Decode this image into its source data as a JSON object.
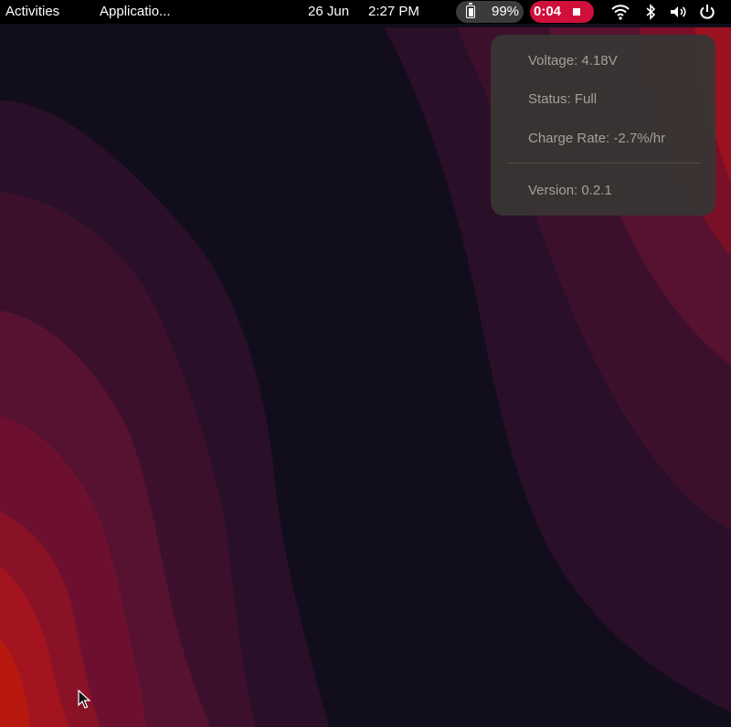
{
  "topbar": {
    "activities": "Activities",
    "applications": "Applicatio...",
    "date": "26 Jun",
    "time": "2:27 PM",
    "battery_percent": "99%",
    "recording_time": "0:04",
    "icons": [
      "battery-icon",
      "stop-icon",
      "wifi-icon",
      "bluetooth-icon",
      "volume-icon",
      "power-icon"
    ]
  },
  "battery_popup": {
    "voltage": "Voltage: 4.18V",
    "status": "Status: Full",
    "charge_rate": "Charge Rate: -2.7%/hr",
    "version": "Version: 0.2.1"
  },
  "colors": {
    "topbar_bg": "#000000",
    "recording_accent": "#d00f3b",
    "popup_bg": "#383533",
    "popup_text": "#a4a09c"
  }
}
